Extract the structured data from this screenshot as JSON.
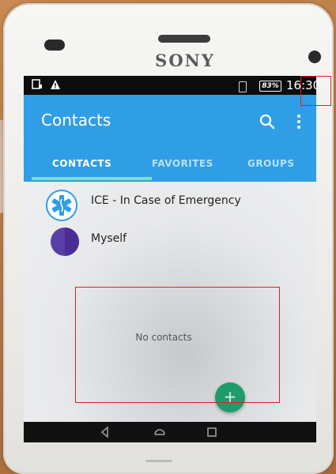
{
  "device": {
    "brand": "SONY"
  },
  "status_bar": {
    "left_icons": [
      "sd-card-icon",
      "warning-icon"
    ],
    "battery_percent": "83%",
    "time": "16:30"
  },
  "app_bar": {
    "title": "Contacts",
    "search_icon": "search-icon",
    "more_icon": "more-vert-icon"
  },
  "tabs": [
    {
      "label": "CONTACTS",
      "active": true
    },
    {
      "label": "FAVORITES",
      "active": false
    },
    {
      "label": "GROUPS",
      "active": false
    }
  ],
  "contacts": [
    {
      "label": "ICE - In Case of Emergency",
      "icon": "medical-star-icon"
    },
    {
      "label": "Myself",
      "icon": "avatar"
    }
  ],
  "empty_state": {
    "text": "No contacts"
  },
  "fab": {
    "label": "+"
  },
  "nav_bar": {
    "icons": [
      "back-icon",
      "home-icon",
      "recents-icon"
    ]
  },
  "colors": {
    "accent": "#2f9ee6",
    "tab_indicator": "#7ee0c6",
    "fab": "#1e9c6a",
    "annotation": "#e02020"
  }
}
